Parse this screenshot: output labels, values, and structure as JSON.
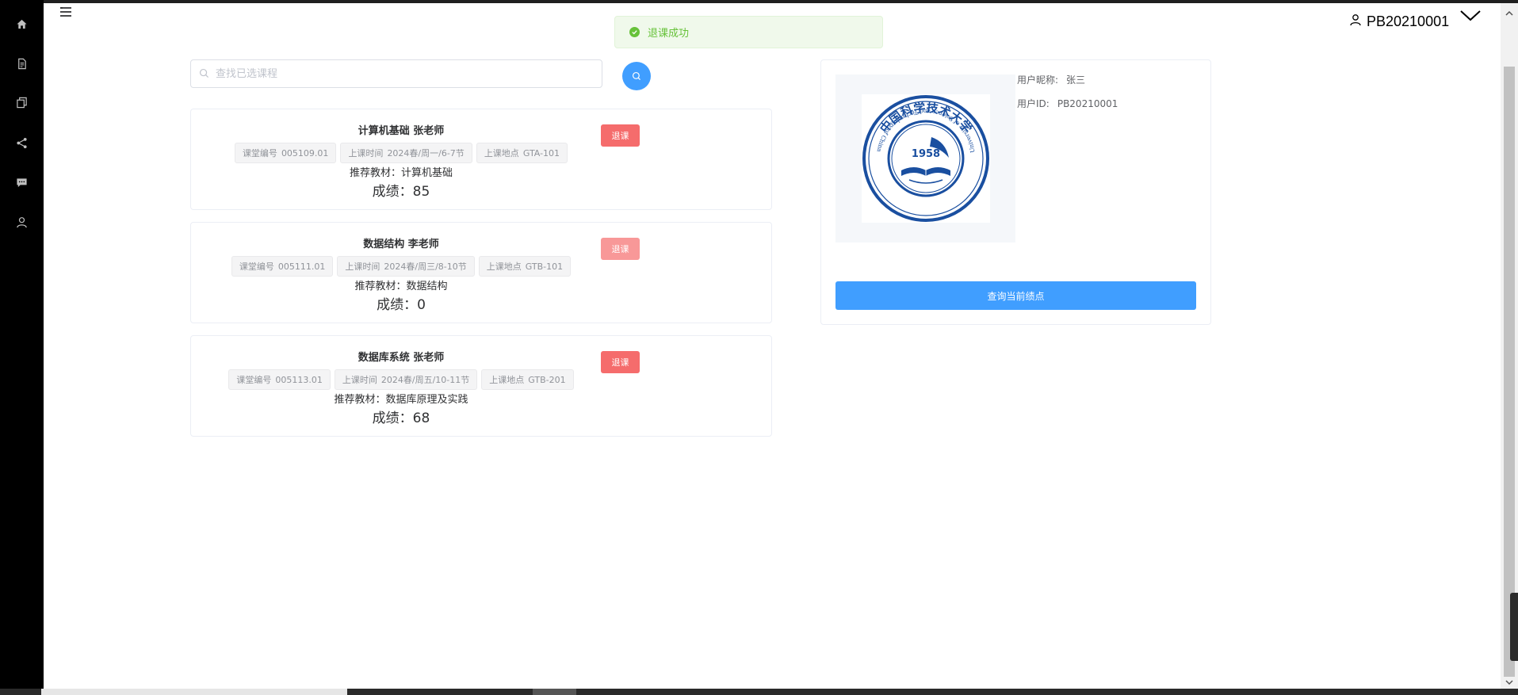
{
  "header": {
    "username": "PB20210001"
  },
  "toast": {
    "message": "退课成功",
    "color": "#67c23a"
  },
  "search": {
    "placeholder": "查找已选课程",
    "value": ""
  },
  "courses": [
    {
      "title": "计算机基础 张老师",
      "tags": [
        {
          "label": "课堂编号",
          "value": "005109.01"
        },
        {
          "label": "上课时间",
          "value": "2024春/周一/6-7节"
        },
        {
          "label": "上课地点",
          "value": "GTA-101"
        }
      ],
      "textbook_label": "推荐教材：",
      "textbook": "计算机基础",
      "score_label": "成绩：",
      "score": "85",
      "drop_label": "退课"
    },
    {
      "title": "数据结构 李老师",
      "tags": [
        {
          "label": "课堂编号",
          "value": "005111.01"
        },
        {
          "label": "上课时间",
          "value": "2024春/周三/8-10节"
        },
        {
          "label": "上课地点",
          "value": "GTB-101"
        }
      ],
      "textbook_label": "推荐教材：",
      "textbook": "数据结构",
      "score_label": "成绩：",
      "score": "0",
      "drop_label": "退课"
    },
    {
      "title": "数据库系统 张老师",
      "tags": [
        {
          "label": "课堂编号",
          "value": "005113.01"
        },
        {
          "label": "上课时间",
          "value": "2024春/周五/10-11节"
        },
        {
          "label": "上课地点",
          "value": "GTB-201"
        }
      ],
      "textbook_label": "推荐教材：",
      "textbook": "数据库原理及实践",
      "score_label": "成绩：",
      "score": "68",
      "drop_label": "退课"
    }
  ],
  "profile": {
    "nickname_label": "用户昵称:",
    "nickname": "张三",
    "id_label": "用户ID:",
    "id": "PB20210001",
    "logo": {
      "year": "1958",
      "ring_text": "University of Science and Technology of China",
      "chinese_name": "中国科学技术大学"
    },
    "gpa_button": "查询当前绩点"
  },
  "sidebar": {
    "icons": [
      "home-icon",
      "document-icon",
      "copy-icon",
      "share-icon",
      "chat-icon",
      "user-icon"
    ]
  },
  "colors": {
    "primary": "#409eff",
    "danger": "#f56c6c",
    "danger_light": "#f89898",
    "success": "#67c23a"
  }
}
